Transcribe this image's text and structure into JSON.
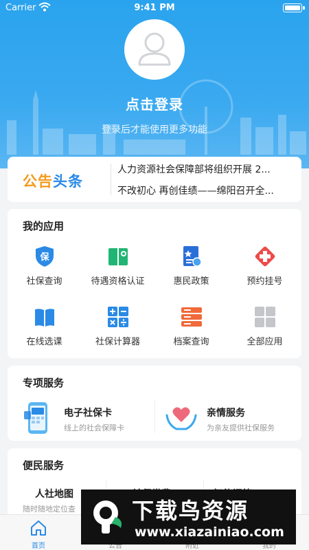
{
  "status_bar": {
    "carrier": "Carrier",
    "time": "9:41 PM"
  },
  "header": {
    "login_title": "点击登录",
    "login_subtitle": "登录后才能使用更多功能"
  },
  "notice": {
    "logo_part1": "公告",
    "logo_part2": "头条",
    "lines": [
      "人力资源社会保障部将组织开展 2...",
      "不改初心 再创佳绩——绵阳召开全..."
    ]
  },
  "my_apps": {
    "title": "我的应用",
    "items": [
      {
        "label": "社保查询",
        "icon": "shield-bao-icon"
      },
      {
        "label": "待遇资格认证",
        "icon": "green-book-icon"
      },
      {
        "label": "惠民政策",
        "icon": "policy-doc-icon"
      },
      {
        "label": "预约挂号",
        "icon": "medical-cross-icon"
      },
      {
        "label": "在线选课",
        "icon": "open-book-icon"
      },
      {
        "label": "社保计算器",
        "icon": "calculator-icon"
      },
      {
        "label": "档案查询",
        "icon": "archive-icon"
      },
      {
        "label": "全部应用",
        "icon": "grid-icon"
      }
    ]
  },
  "special_services": {
    "title": "专项服务",
    "items": [
      {
        "title": "电子社保卡",
        "desc": "线上的社会保障卡",
        "icon": "phone-card-icon"
      },
      {
        "title": "亲情服务",
        "desc": "为亲友提供社保服务",
        "icon": "heart-hands-icon"
      }
    ]
  },
  "convenient_services": {
    "title": "便民服务",
    "items": [
      {
        "title": "人社地图",
        "desc": "随时随地定位查"
      },
      {
        "title": "社保缴费",
        "desc": ""
      },
      {
        "title": "智能问答12333",
        "desc": ""
      }
    ]
  },
  "tabbar": {
    "items": [
      {
        "label": "首页",
        "icon": "home-icon",
        "active": true
      },
      {
        "label": "公告",
        "icon": "notice-icon",
        "active": false
      },
      {
        "label": "附近",
        "icon": "location-icon",
        "active": false
      },
      {
        "label": "我的",
        "icon": "user-icon",
        "active": false
      }
    ]
  },
  "watermark": {
    "title": "下载鸟资源",
    "url": "www.xiazainiao.com"
  },
  "colors": {
    "primary": "#2aa3ee",
    "accent_blue": "#2a8ae6",
    "accent_orange": "#f39a1e",
    "red": "#ee4a4a",
    "green": "#21b573"
  }
}
